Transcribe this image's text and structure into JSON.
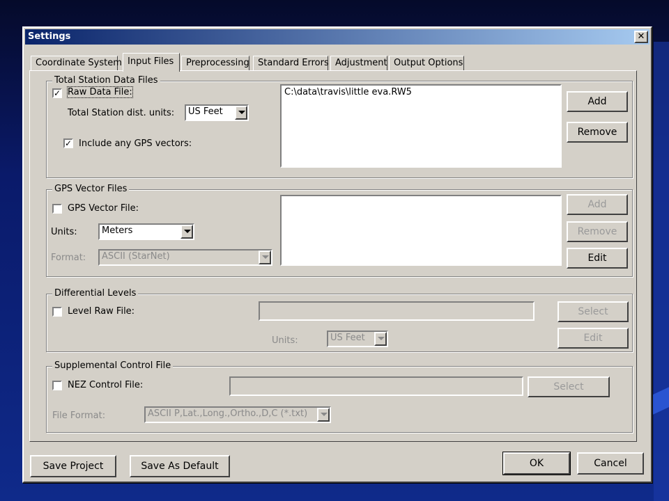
{
  "window": {
    "title": "Settings",
    "close_glyph": "✕"
  },
  "tabs": [
    {
      "label": "Coordinate System"
    },
    {
      "label": "Input Files"
    },
    {
      "label": "Preprocessing"
    },
    {
      "label": "Standard Errors"
    },
    {
      "label": "Adjustment"
    },
    {
      "label": "Output Options"
    }
  ],
  "active_tab": "Input Files",
  "total_station": {
    "group_title": "Total Station Data Files",
    "raw_data_checked": true,
    "raw_data_label": "Raw Data File:",
    "units_label": "Total Station dist. units:",
    "units_value": "US Feet",
    "gps_vectors_checked": true,
    "gps_vectors_label": "Include any GPS vectors:",
    "files": [
      "C:\\data\\travis\\little eva.RW5"
    ],
    "add_label": "Add",
    "remove_label": "Remove"
  },
  "gps_vector": {
    "group_title": "GPS Vector Files",
    "file_checked": false,
    "file_label": "GPS Vector File:",
    "units_label": "Units:",
    "units_value": "Meters",
    "format_label": "Format:",
    "format_value": "ASCII (StarNet)",
    "add_label": "Add",
    "remove_label": "Remove",
    "edit_label": "Edit"
  },
  "diff_levels": {
    "group_title": "Differential Levels",
    "raw_checked": false,
    "raw_label": "Level Raw File:",
    "select_label": "Select",
    "units_label": "Units:",
    "units_value": "US Feet",
    "edit_label": "Edit"
  },
  "supplemental": {
    "group_title": "Supplemental Control File",
    "nez_checked": false,
    "nez_label": "NEZ Control File:",
    "select_label": "Select",
    "format_label": "File Format:",
    "format_value": "ASCII P,Lat.,Long.,Ortho.,D,C (*.txt)"
  },
  "footer": {
    "save_project": "Save Project",
    "save_default": "Save As Default",
    "ok": "OK",
    "cancel": "Cancel"
  },
  "colors": {
    "dialog_bg": "#d4d0c8",
    "titlebar": "#0a246a",
    "desktop": "#0a1a6a"
  }
}
